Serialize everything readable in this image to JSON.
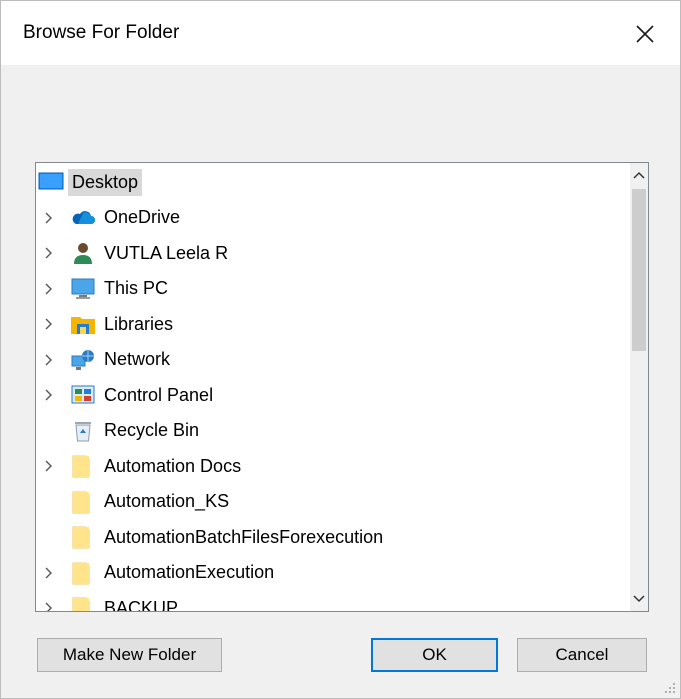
{
  "dialog": {
    "title": "Browse For Folder",
    "close_icon": "close-icon"
  },
  "tree": {
    "items": [
      {
        "label": "Desktop",
        "icon": "desktop-icon",
        "expandable": false,
        "selected": true,
        "level": 0
      },
      {
        "label": "OneDrive",
        "icon": "onedrive-cloud-icon",
        "expandable": true,
        "level": 1
      },
      {
        "label": "VUTLA Leela R",
        "icon": "user-icon",
        "expandable": true,
        "level": 1
      },
      {
        "label": "This PC",
        "icon": "this-pc-icon",
        "expandable": true,
        "level": 1
      },
      {
        "label": "Libraries",
        "icon": "libraries-icon",
        "expandable": true,
        "level": 1
      },
      {
        "label": "Network",
        "icon": "network-icon",
        "expandable": true,
        "level": 1
      },
      {
        "label": "Control Panel",
        "icon": "control-panel-icon",
        "expandable": true,
        "level": 1
      },
      {
        "label": "Recycle Bin",
        "icon": "recycle-bin-icon",
        "expandable": false,
        "level": 1
      },
      {
        "label": "Automation Docs",
        "icon": "folder-icon",
        "expandable": true,
        "level": 1
      },
      {
        "label": "Automation_KS",
        "icon": "folder-icon",
        "expandable": false,
        "level": 1
      },
      {
        "label": "AutomationBatchFilesForexecution",
        "icon": "folder-icon",
        "expandable": false,
        "level": 1
      },
      {
        "label": "AutomationExecution",
        "icon": "folder-icon",
        "expandable": true,
        "level": 1
      },
      {
        "label": "BACKUP",
        "icon": "folder-icon",
        "expandable": true,
        "level": 1
      }
    ]
  },
  "buttons": {
    "make_new_folder": "Make New Folder",
    "ok": "OK",
    "cancel": "Cancel"
  },
  "colors": {
    "selection": "#d9d9d9",
    "default_button_border": "#0078d7",
    "folder": "#ffd966"
  }
}
